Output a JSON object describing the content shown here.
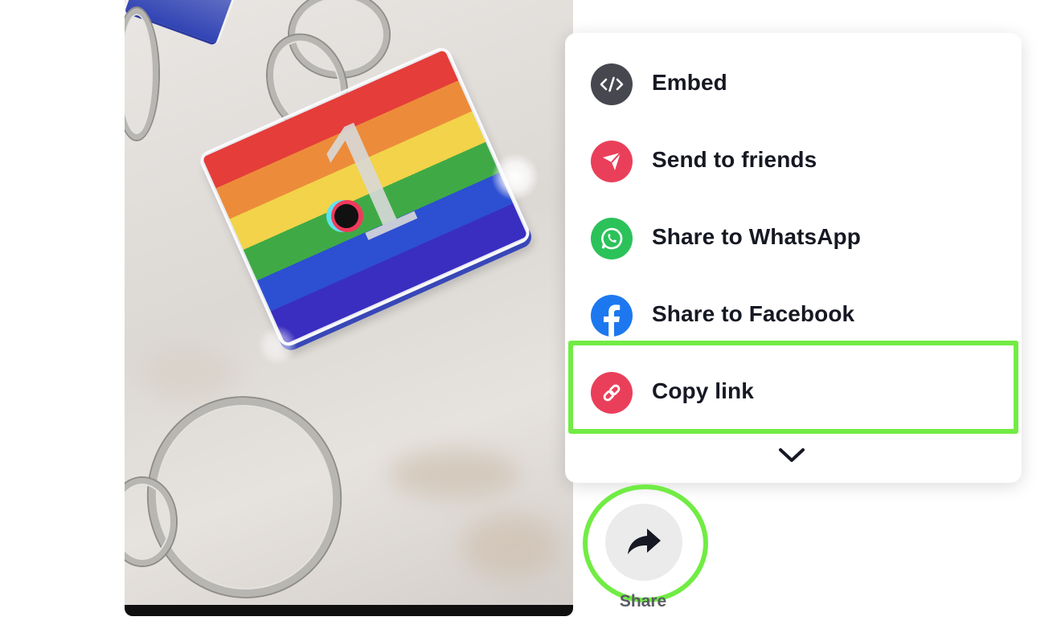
{
  "share_menu": {
    "items": [
      {
        "label": "Embed",
        "icon": "embed-code-icon",
        "color": "#47484f"
      },
      {
        "label": "Send to friends",
        "icon": "paper-plane-icon",
        "color": "#ea3f5a"
      },
      {
        "label": "Share to WhatsApp",
        "icon": "whatsapp-icon",
        "color": "#2cc25a"
      },
      {
        "label": "Share to Facebook",
        "icon": "facebook-icon",
        "color": "#1d78f0"
      },
      {
        "label": "Copy link",
        "icon": "link-icon",
        "color": "#ea3f5a"
      }
    ],
    "expand_icon": "chevron-down-icon",
    "highlighted_item": "Copy link"
  },
  "share_button": {
    "label": "Share",
    "icon": "share-arrow-icon"
  },
  "annotation": {
    "highlight_color": "#71ec44"
  },
  "video": {
    "icon": "tiktok-dot-icon"
  }
}
